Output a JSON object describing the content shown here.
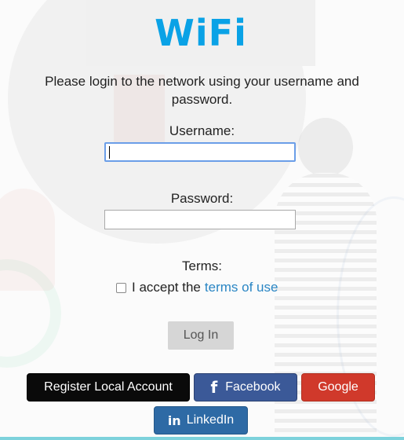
{
  "logo": {
    "text": "WiFi",
    "color": "#0aa2e6"
  },
  "intro_text": "Please login to the network using your username and password.",
  "username": {
    "label": "Username:",
    "value": "",
    "placeholder": ""
  },
  "password": {
    "label": "Password:",
    "value": "",
    "placeholder": ""
  },
  "terms": {
    "label": "Terms:",
    "accept_text": "I accept the",
    "link_text": "terms of use",
    "checked": false
  },
  "login_button": "Log In",
  "social": {
    "register": "Register Local Account",
    "facebook": {
      "icon": "f",
      "label": "Facebook"
    },
    "google": "Google",
    "linkedin": {
      "icon": "in",
      "label": "LinkedIn"
    }
  },
  "colors": {
    "facebook": "#3b5998",
    "google": "#d0392b",
    "linkedin": "#2e6aa5",
    "register": "#0a0a0a",
    "link": "#2a86c4"
  }
}
